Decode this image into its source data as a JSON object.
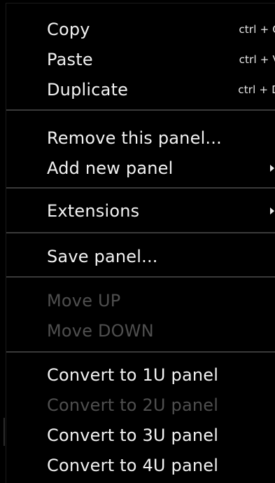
{
  "menu": {
    "items": {
      "copy": {
        "label": "Copy",
        "shortcut": "ctrl + C"
      },
      "paste": {
        "label": "Paste",
        "shortcut": "ctrl + V"
      },
      "duplicate": {
        "label": "Duplicate",
        "shortcut": "ctrl + D"
      },
      "remove_panel": {
        "label": "Remove this panel..."
      },
      "add_new_panel": {
        "label": "Add new panel"
      },
      "extensions": {
        "label": "Extensions"
      },
      "save_panel": {
        "label": "Save panel..."
      },
      "move_up": {
        "label": "Move UP"
      },
      "move_down": {
        "label": "Move DOWN"
      },
      "convert_1u": {
        "label": "Convert to 1U panel"
      },
      "convert_2u": {
        "label": "Convert to 2U panel"
      },
      "convert_3u": {
        "label": "Convert to 3U panel"
      },
      "convert_4u": {
        "label": "Convert to 4U panel"
      }
    },
    "icons": {
      "submenu_arrow": "triangle-right"
    },
    "colors": {
      "background": "#000000",
      "text": "#f2f2f2",
      "disabled_text": "#4f4f4f",
      "separator": "#3a3a3a"
    }
  }
}
